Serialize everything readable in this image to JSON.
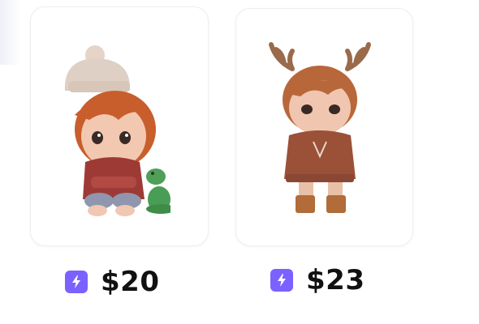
{
  "products": [
    {
      "image_icon": "figure-beanie-boy-with-green-dinosaur",
      "currency_icon": "lightning-bolt-icon",
      "price": "$20"
    },
    {
      "image_icon": "figure-reindeer-antler-boy-in-hoodie",
      "currency_icon": "lightning-bolt-icon",
      "price": "$23"
    }
  ],
  "colors": {
    "bolt_badge": "#7b61ff",
    "price_text": "#111111",
    "card_border": "#eceef2"
  }
}
